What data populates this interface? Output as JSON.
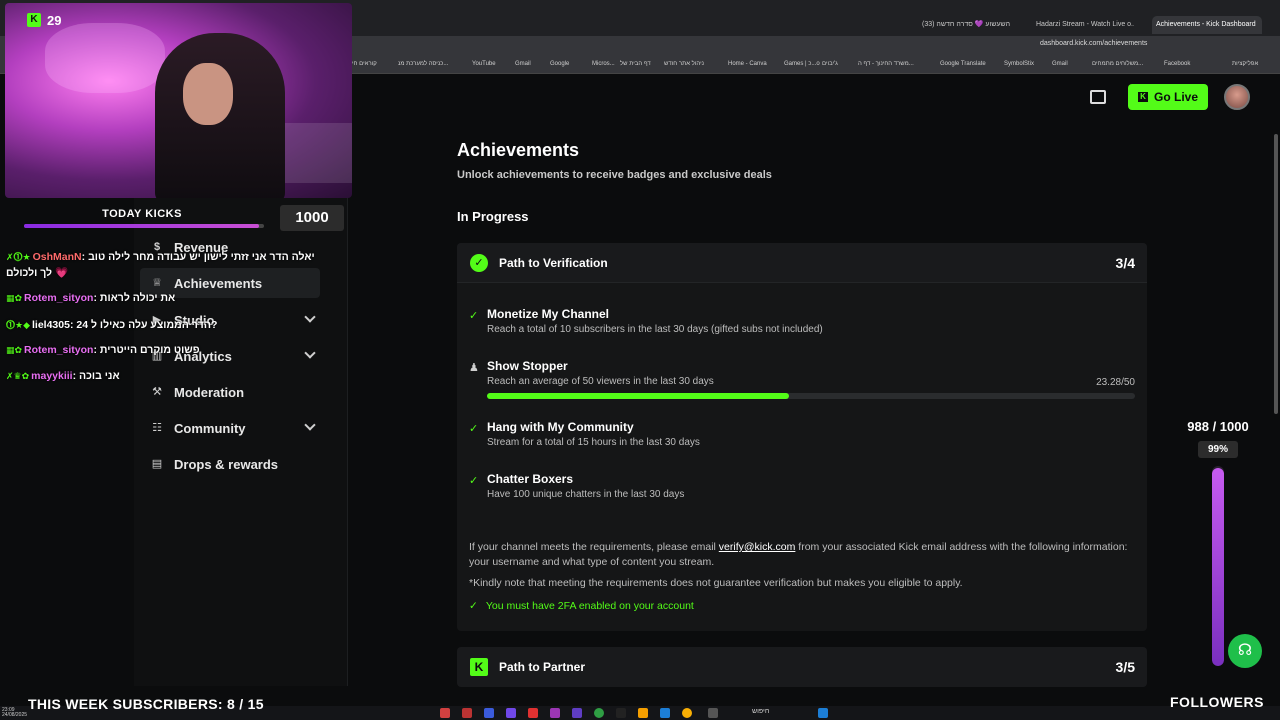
{
  "browser": {
    "tabs": [
      {
        "label": "השעשוע 💜 סדרה חדשה (33)",
        "active": false
      },
      {
        "label": "Hadarzi Stream - Watch Live o...",
        "active": false
      },
      {
        "label": "Achievements - Kick Dashboard",
        "active": true
      }
    ],
    "url": "dashboard.kick.com/achievements",
    "bookmarks": [
      "קוראים חי",
      "כניסה למערכת מנ...",
      "YouTube",
      "Gmail",
      "Google",
      "Micros...",
      "דף הבית של",
      "ניהול אתר חודש",
      "Home - Canva",
      "Games | כ...o",
      "ג'יבוים",
      "משרד החינוך - דף ה...",
      "Google Translate",
      "SymbolStix",
      "Gmail",
      "משלוחים מתמחים...",
      "Facebook",
      "אפליקציות"
    ]
  },
  "header": {
    "go_live_label": "Go Live",
    "store_icon": "store-icon",
    "avatar": "user-avatar"
  },
  "sidebar": {
    "items": [
      {
        "label": "Revenue",
        "icon": "dollar-icon"
      },
      {
        "label": "Achievements",
        "icon": "trophy-icon",
        "active": true
      },
      {
        "label": "Studio",
        "icon": "video-icon",
        "expandable": true
      },
      {
        "label": "Analytics",
        "icon": "chart-icon",
        "expandable": true
      },
      {
        "label": "Moderation",
        "icon": "hammer-icon"
      },
      {
        "label": "Community",
        "icon": "people-icon",
        "expandable": true
      },
      {
        "label": "Drops & rewards",
        "icon": "gift-icon"
      }
    ]
  },
  "main": {
    "title": "Achievements",
    "subtitle": "Unlock achievements to receive badges and exclusive deals",
    "section_title": "In Progress",
    "verification": {
      "title": "Path to Verification",
      "count": "3/4",
      "tasks": [
        {
          "name": "Monetize My Channel",
          "desc": "Reach a total of 10 subscribers in the last 30 days (gifted subs not included)",
          "done": true
        },
        {
          "name": "Show Stopper",
          "desc": "Reach an average of 50 viewers in the last 30 days",
          "done": false,
          "progress_label": "23.28/50",
          "progress": 0.4656
        },
        {
          "name": "Hang with My Community",
          "desc": "Stream for a total of 15 hours in the last 30 days",
          "done": true
        },
        {
          "name": "Chatter Boxers",
          "desc": "Have 100 unique chatters in the last 30 days",
          "done": true
        }
      ],
      "info_prefix": "If your channel meets the requirements, please email ",
      "info_email": "verify@kick.com",
      "info_suffix": " from your associated Kick email address with the following information: your username and what type of content you stream.",
      "note": "*Kindly note that meeting the requirements does not guarantee verification but makes you eligible to apply.",
      "twofa": "You must have 2FA enabled on your account"
    },
    "partner": {
      "title": "Path to Partner",
      "count": "3/5"
    }
  },
  "stream_overlay": {
    "viewer_count": "29",
    "today_kicks_label": "TODAY KICKS",
    "today_kicks_value": "1000",
    "today_kicks_progress": 0.98,
    "chat": [
      {
        "user": "OshManN",
        "msg": "יאלה הדר אני זזתי לישון יש עבודה מחר לילה טוב",
        "icons": "✗⓵★",
        "cont": "לך ולכולם 💗"
      },
      {
        "user": "Rotem_sityon",
        "msg": "את יכולה לראות",
        "icons": "▦✿"
      },
      {
        "user": "liel4305",
        "msg": "הדר הממוצע עלה כאילו ל 24?",
        "icons": "⓵★◆"
      },
      {
        "user": "Rotem_sityon",
        "msg": "פשוט מוקרם הייטרית",
        "icons": "▦✿"
      },
      {
        "user": "mayykiii",
        "msg": "אני בוכה",
        "icons": "✗♛✿"
      }
    ],
    "subscribers_goal": "THIS WEEK SUBSCRIBERS: 8 / 15",
    "followers_label": "FOLLOWERS",
    "followers_count": "988 / 1000",
    "followers_percent": "99%",
    "followers_progress": 0.99
  },
  "taskbar": {
    "search_label": "חיפוש",
    "time": "23:09",
    "date": "24/08/2025"
  },
  "colors": {
    "accent": "#53fc18",
    "background": "#0b0c0d",
    "card": "#151617"
  }
}
